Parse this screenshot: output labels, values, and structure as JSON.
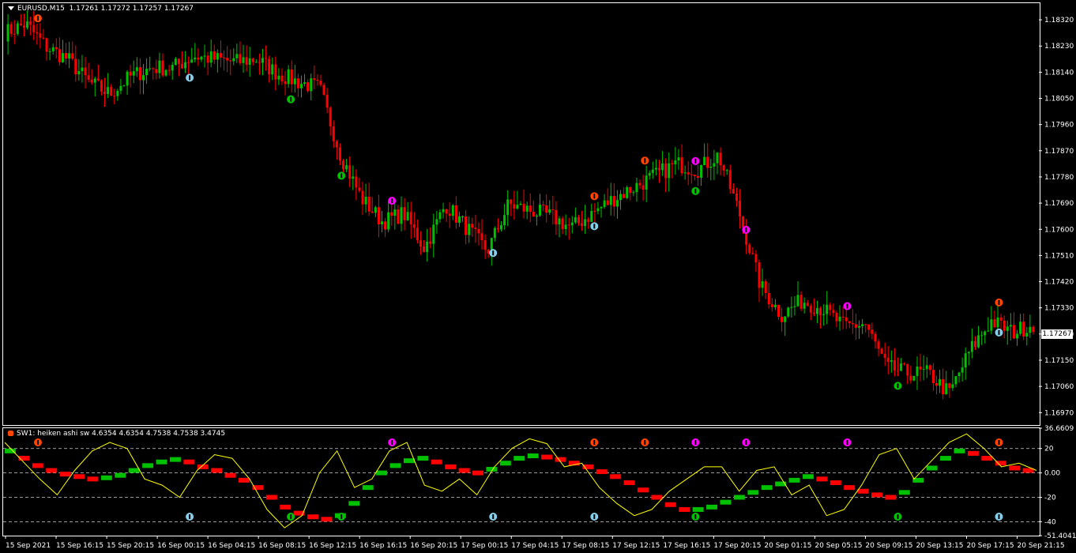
{
  "main_header": {
    "menu_icon": "triangle-down-icon",
    "symbol": "EURUSD,M15",
    "ohlc": "1.17261 1.17272 1.17257 1.17267"
  },
  "sub_header": {
    "indicator_icon": "indicator-icon",
    "title": "SW1: heiken ashi sw 4.6354 4.6354 4.7538 4.7538 3.4745"
  },
  "current_price": "1.17267",
  "colors": {
    "background": "#000000",
    "bull": "#00c000",
    "bear": "#ff0000",
    "signal_line": "#ffff00",
    "up_arrow_orange": "#ff4500",
    "up_arrow_magenta": "#ff00ff",
    "down_arrow_lightblue": "#87ceeb",
    "down_arrow_green": "#00c000",
    "trend_magenta": "#ff00ff",
    "trend_white": "#ffffff",
    "trend_orange": "#ff4500",
    "trend_green": "#00c000"
  },
  "chart_data": [
    {
      "type": "candlestick",
      "symbol": "EURUSD",
      "timeframe": "M15",
      "ylim": [
        1.1693,
        1.1838
      ],
      "y_ticks": [
        "1.18320",
        "1.18230",
        "1.18140",
        "1.18050",
        "1.17960",
        "1.17870",
        "1.17780",
        "1.17690",
        "1.17600",
        "1.17510",
        "1.17420",
        "1.17330",
        "1.17240",
        "1.17150",
        "1.17060",
        "1.16970"
      ],
      "x_ticks": [
        "15 Sep 2021",
        "15 Sep 16:15",
        "15 Sep 20:15",
        "16 Sep 00:15",
        "16 Sep 04:15",
        "16 Sep 08:15",
        "16 Sep 12:15",
        "16 Sep 16:15",
        "16 Sep 20:15",
        "17 Sep 00:15",
        "17 Sep 04:15",
        "17 Sep 08:15",
        "17 Sep 12:15",
        "17 Sep 16:15",
        "17 Sep 20:15",
        "20 Sep 01:15",
        "20 Sep 05:15",
        "20 Sep 09:15",
        "20 Sep 13:15",
        "20 Sep 17:15",
        "20 Sep 21:15"
      ],
      "price_path": [
        1.1827,
        1.183,
        1.1822,
        1.1818,
        1.181,
        1.1806,
        1.1812,
        1.1815,
        1.1815,
        1.1819,
        1.1818,
        1.1817,
        1.1818,
        1.1813,
        1.181,
        1.1808,
        1.1785,
        1.177,
        1.1762,
        1.1765,
        1.1753,
        1.1768,
        1.176,
        1.1752,
        1.1768,
        1.1766,
        1.1764,
        1.176,
        1.1765,
        1.177,
        1.1774,
        1.1778,
        1.1782,
        1.178,
        1.1785,
        1.1765,
        1.174,
        1.173,
        1.1735,
        1.1732,
        1.1726,
        1.1727,
        1.1712,
        1.171,
        1.171,
        1.1703,
        1.1718,
        1.1728,
        1.1724,
        1.1727
      ],
      "up_markers": [
        {
          "t": "15 Sep 2021",
          "color": "orange"
        },
        {
          "t": "16 Sep 16:15",
          "color": "magenta"
        },
        {
          "t": "17 Sep 08:15",
          "color": "orange"
        },
        {
          "t": "17 Sep 12:15",
          "color": "orange"
        },
        {
          "t": "17 Sep 16:15",
          "color": "magenta"
        },
        {
          "t": "17 Sep 20:15",
          "color": "magenta"
        },
        {
          "t": "20 Sep 05:15",
          "color": "magenta"
        },
        {
          "t": "20 Sep 17:15",
          "color": "orange"
        }
      ],
      "down_markers": [
        {
          "t": "16 Sep 00:15",
          "color": "lightblue"
        },
        {
          "t": "16 Sep 08:15",
          "color": "green"
        },
        {
          "t": "16 Sep 12:15",
          "color": "green"
        },
        {
          "t": "17 Sep 00:15",
          "color": "lightblue"
        },
        {
          "t": "17 Sep 08:15",
          "color": "lightblue"
        },
        {
          "t": "17 Sep 16:15",
          "color": "green"
        },
        {
          "t": "20 Sep 09:15",
          "color": "green"
        },
        {
          "t": "20 Sep 17:15",
          "color": "lightblue"
        }
      ]
    },
    {
      "type": "histogram",
      "name": "heiken ashi sw",
      "ylim": [
        -51.4041,
        36.6609
      ],
      "y_ticks": [
        "36.6609",
        "20",
        "0.00",
        "-20",
        "-40",
        "-51.4041"
      ],
      "levels": [
        20,
        0,
        -20,
        -40
      ],
      "values": [
        18,
        12,
        6,
        2,
        -1,
        -3,
        -5,
        -4,
        -2,
        2,
        6,
        9,
        11,
        9,
        5,
        2,
        -2,
        -6,
        -12,
        -20,
        -28,
        -33,
        -36,
        -38,
        -35,
        -25,
        -12,
        0,
        6,
        10,
        12,
        9,
        5,
        2,
        0,
        3,
        8,
        12,
        14,
        13,
        11,
        8,
        5,
        1,
        -3,
        -8,
        -14,
        -20,
        -26,
        -30,
        -30,
        -28,
        -24,
        -20,
        -16,
        -12,
        -9,
        -6,
        -3,
        -5,
        -8,
        -12,
        -15,
        -18,
        -20,
        -16,
        -6,
        4,
        12,
        18,
        16,
        12,
        8,
        4,
        2
      ],
      "signal": [
        25,
        10,
        -5,
        -18,
        2,
        18,
        25,
        20,
        -5,
        -10,
        -20,
        2,
        15,
        12,
        -5,
        -30,
        -45,
        -35,
        0,
        18,
        -12,
        -5,
        18,
        25,
        -10,
        -15,
        -5,
        -18,
        5,
        20,
        28,
        24,
        5,
        8,
        -12,
        -25,
        -35,
        -30,
        -15,
        -5,
        5,
        5,
        -15,
        2,
        5,
        -18,
        -10,
        -35,
        -30,
        -10,
        15,
        20,
        -5,
        10,
        25,
        32,
        20,
        5,
        8,
        2
      ]
    }
  ]
}
